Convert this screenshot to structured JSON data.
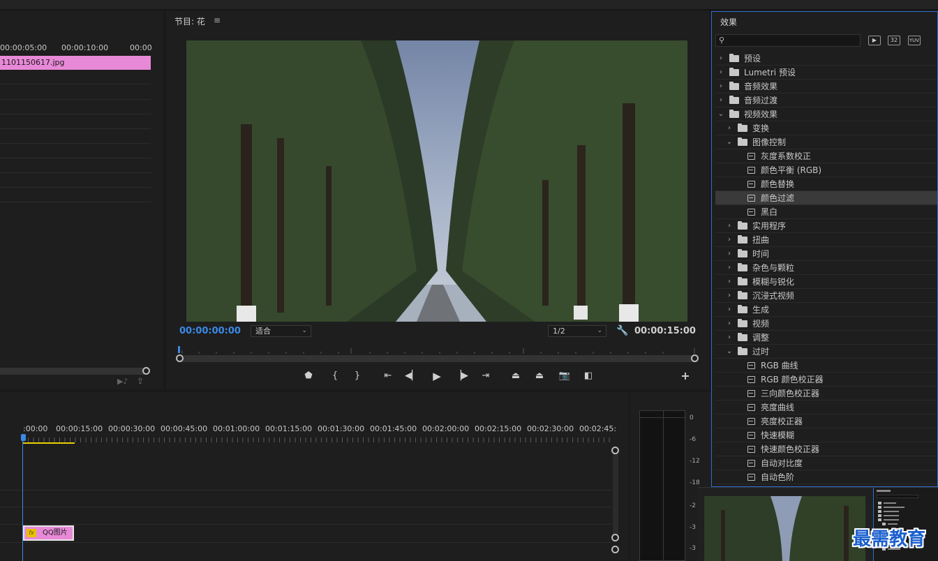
{
  "source": {
    "ruler": [
      "00:00:05:00",
      "00:00:10:00",
      "00:00"
    ],
    "clip_name": "1101150617.jpg"
  },
  "program": {
    "title": "节目: 花",
    "menu_icon": "hamburger-icon",
    "timecode_current": "00:00:00:00",
    "timecode_duration": "00:00:15:00",
    "fit_select": "适合",
    "resolution_select": "1/2",
    "controls": [
      "marker-icon",
      "mark-in-icon",
      "mark-out-icon",
      "go-to-in-icon",
      "step-back-icon",
      "play-icon",
      "step-forward-icon",
      "go-to-out-icon",
      "lift-icon",
      "extract-icon",
      "export-frame-icon",
      "compare-icon",
      "add-button-icon"
    ]
  },
  "effects": {
    "title": "效果",
    "search_placeholder": "",
    "buttons": [
      "▶",
      "32",
      "YUV"
    ],
    "tree": [
      {
        "label": "预设",
        "level": 0,
        "kind": "folder-star",
        "expanded": false
      },
      {
        "label": "Lumetri 预设",
        "level": 0,
        "kind": "folder-star",
        "expanded": false
      },
      {
        "label": "音频效果",
        "level": 0,
        "kind": "folder",
        "expanded": false
      },
      {
        "label": "音频过渡",
        "level": 0,
        "kind": "folder",
        "expanded": false
      },
      {
        "label": "视频效果",
        "level": 0,
        "kind": "folder",
        "expanded": true
      },
      {
        "label": "变换",
        "level": 1,
        "kind": "folder",
        "expanded": false
      },
      {
        "label": "图像控制",
        "level": 1,
        "kind": "folder",
        "expanded": true
      },
      {
        "label": "灰度系数校正",
        "level": 2,
        "kind": "effect"
      },
      {
        "label": "颜色平衡 (RGB)",
        "level": 2,
        "kind": "effect"
      },
      {
        "label": "颜色替换",
        "level": 2,
        "kind": "effect"
      },
      {
        "label": "颜色过滤",
        "level": 2,
        "kind": "effect",
        "selected": true
      },
      {
        "label": "黑白",
        "level": 2,
        "kind": "effect"
      },
      {
        "label": "实用程序",
        "level": 1,
        "kind": "folder",
        "expanded": false
      },
      {
        "label": "扭曲",
        "level": 1,
        "kind": "folder",
        "expanded": false
      },
      {
        "label": "时间",
        "level": 1,
        "kind": "folder",
        "expanded": false
      },
      {
        "label": "杂色与颗粒",
        "level": 1,
        "kind": "folder",
        "expanded": false
      },
      {
        "label": "模糊与锐化",
        "level": 1,
        "kind": "folder",
        "expanded": false
      },
      {
        "label": "沉浸式视频",
        "level": 1,
        "kind": "folder",
        "expanded": false
      },
      {
        "label": "生成",
        "level": 1,
        "kind": "folder",
        "expanded": false
      },
      {
        "label": "视频",
        "level": 1,
        "kind": "folder",
        "expanded": false
      },
      {
        "label": "调整",
        "level": 1,
        "kind": "folder",
        "expanded": false
      },
      {
        "label": "过时",
        "level": 1,
        "kind": "folder",
        "expanded": true
      },
      {
        "label": "RGB 曲线",
        "level": 2,
        "kind": "effect"
      },
      {
        "label": "RGB 颜色校正器",
        "level": 2,
        "kind": "effect"
      },
      {
        "label": "三向颜色校正器",
        "level": 2,
        "kind": "effect"
      },
      {
        "label": "亮度曲线",
        "level": 2,
        "kind": "effect"
      },
      {
        "label": "亮度校正器",
        "level": 2,
        "kind": "effect"
      },
      {
        "label": "快速模糊",
        "level": 2,
        "kind": "effect"
      },
      {
        "label": "快速颜色校正器",
        "level": 2,
        "kind": "effect"
      },
      {
        "label": "自动对比度",
        "level": 2,
        "kind": "effect"
      },
      {
        "label": "自动色阶",
        "level": 2,
        "kind": "effect"
      }
    ]
  },
  "timeline": {
    "ruler": [
      ":00:00",
      "00:00:15:00",
      "00:00:30:00",
      "00:00:45:00",
      "00:01:00:00",
      "00:01:15:00",
      "00:01:30:00",
      "00:01:45:00",
      "00:02:00:00",
      "00:02:15:00",
      "00:02:30:00",
      "00:02:45:"
    ],
    "clip_name": "QQ图片",
    "clip_badge": "fx"
  },
  "meters": {
    "labels": [
      "0",
      "-6",
      "-12",
      "-18",
      "-2",
      "-3",
      "-3"
    ]
  },
  "watermark": "最需教育"
}
